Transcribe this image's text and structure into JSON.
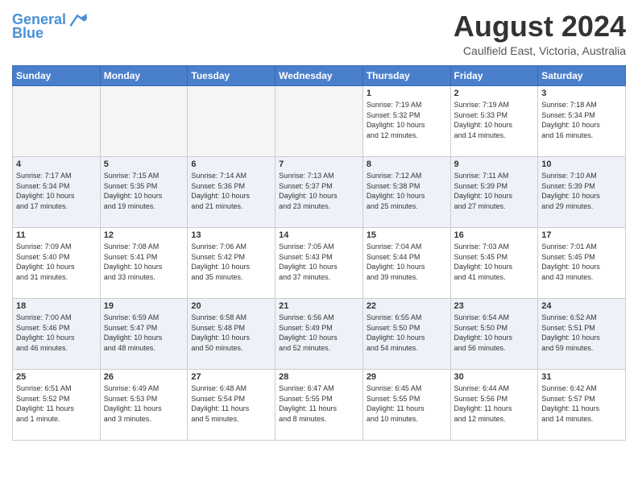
{
  "logo": {
    "line1": "General",
    "line2": "Blue"
  },
  "title": "August 2024",
  "location": "Caulfield East, Victoria, Australia",
  "headers": [
    "Sunday",
    "Monday",
    "Tuesday",
    "Wednesday",
    "Thursday",
    "Friday",
    "Saturday"
  ],
  "weeks": [
    [
      {
        "day": "",
        "info": ""
      },
      {
        "day": "",
        "info": ""
      },
      {
        "day": "",
        "info": ""
      },
      {
        "day": "",
        "info": ""
      },
      {
        "day": "1",
        "info": "Sunrise: 7:19 AM\nSunset: 5:32 PM\nDaylight: 10 hours\nand 12 minutes."
      },
      {
        "day": "2",
        "info": "Sunrise: 7:19 AM\nSunset: 5:33 PM\nDaylight: 10 hours\nand 14 minutes."
      },
      {
        "day": "3",
        "info": "Sunrise: 7:18 AM\nSunset: 5:34 PM\nDaylight: 10 hours\nand 16 minutes."
      }
    ],
    [
      {
        "day": "4",
        "info": "Sunrise: 7:17 AM\nSunset: 5:34 PM\nDaylight: 10 hours\nand 17 minutes."
      },
      {
        "day": "5",
        "info": "Sunrise: 7:15 AM\nSunset: 5:35 PM\nDaylight: 10 hours\nand 19 minutes."
      },
      {
        "day": "6",
        "info": "Sunrise: 7:14 AM\nSunset: 5:36 PM\nDaylight: 10 hours\nand 21 minutes."
      },
      {
        "day": "7",
        "info": "Sunrise: 7:13 AM\nSunset: 5:37 PM\nDaylight: 10 hours\nand 23 minutes."
      },
      {
        "day": "8",
        "info": "Sunrise: 7:12 AM\nSunset: 5:38 PM\nDaylight: 10 hours\nand 25 minutes."
      },
      {
        "day": "9",
        "info": "Sunrise: 7:11 AM\nSunset: 5:39 PM\nDaylight: 10 hours\nand 27 minutes."
      },
      {
        "day": "10",
        "info": "Sunrise: 7:10 AM\nSunset: 5:39 PM\nDaylight: 10 hours\nand 29 minutes."
      }
    ],
    [
      {
        "day": "11",
        "info": "Sunrise: 7:09 AM\nSunset: 5:40 PM\nDaylight: 10 hours\nand 31 minutes."
      },
      {
        "day": "12",
        "info": "Sunrise: 7:08 AM\nSunset: 5:41 PM\nDaylight: 10 hours\nand 33 minutes."
      },
      {
        "day": "13",
        "info": "Sunrise: 7:06 AM\nSunset: 5:42 PM\nDaylight: 10 hours\nand 35 minutes."
      },
      {
        "day": "14",
        "info": "Sunrise: 7:05 AM\nSunset: 5:43 PM\nDaylight: 10 hours\nand 37 minutes."
      },
      {
        "day": "15",
        "info": "Sunrise: 7:04 AM\nSunset: 5:44 PM\nDaylight: 10 hours\nand 39 minutes."
      },
      {
        "day": "16",
        "info": "Sunrise: 7:03 AM\nSunset: 5:45 PM\nDaylight: 10 hours\nand 41 minutes."
      },
      {
        "day": "17",
        "info": "Sunrise: 7:01 AM\nSunset: 5:45 PM\nDaylight: 10 hours\nand 43 minutes."
      }
    ],
    [
      {
        "day": "18",
        "info": "Sunrise: 7:00 AM\nSunset: 5:46 PM\nDaylight: 10 hours\nand 46 minutes."
      },
      {
        "day": "19",
        "info": "Sunrise: 6:59 AM\nSunset: 5:47 PM\nDaylight: 10 hours\nand 48 minutes."
      },
      {
        "day": "20",
        "info": "Sunrise: 6:58 AM\nSunset: 5:48 PM\nDaylight: 10 hours\nand 50 minutes."
      },
      {
        "day": "21",
        "info": "Sunrise: 6:56 AM\nSunset: 5:49 PM\nDaylight: 10 hours\nand 52 minutes."
      },
      {
        "day": "22",
        "info": "Sunrise: 6:55 AM\nSunset: 5:50 PM\nDaylight: 10 hours\nand 54 minutes."
      },
      {
        "day": "23",
        "info": "Sunrise: 6:54 AM\nSunset: 5:50 PM\nDaylight: 10 hours\nand 56 minutes."
      },
      {
        "day": "24",
        "info": "Sunrise: 6:52 AM\nSunset: 5:51 PM\nDaylight: 10 hours\nand 59 minutes."
      }
    ],
    [
      {
        "day": "25",
        "info": "Sunrise: 6:51 AM\nSunset: 5:52 PM\nDaylight: 11 hours\nand 1 minute."
      },
      {
        "day": "26",
        "info": "Sunrise: 6:49 AM\nSunset: 5:53 PM\nDaylight: 11 hours\nand 3 minutes."
      },
      {
        "day": "27",
        "info": "Sunrise: 6:48 AM\nSunset: 5:54 PM\nDaylight: 11 hours\nand 5 minutes."
      },
      {
        "day": "28",
        "info": "Sunrise: 6:47 AM\nSunset: 5:55 PM\nDaylight: 11 hours\nand 8 minutes."
      },
      {
        "day": "29",
        "info": "Sunrise: 6:45 AM\nSunset: 5:55 PM\nDaylight: 11 hours\nand 10 minutes."
      },
      {
        "day": "30",
        "info": "Sunrise: 6:44 AM\nSunset: 5:56 PM\nDaylight: 11 hours\nand 12 minutes."
      },
      {
        "day": "31",
        "info": "Sunrise: 6:42 AM\nSunset: 5:57 PM\nDaylight: 11 hours\nand 14 minutes."
      }
    ]
  ]
}
